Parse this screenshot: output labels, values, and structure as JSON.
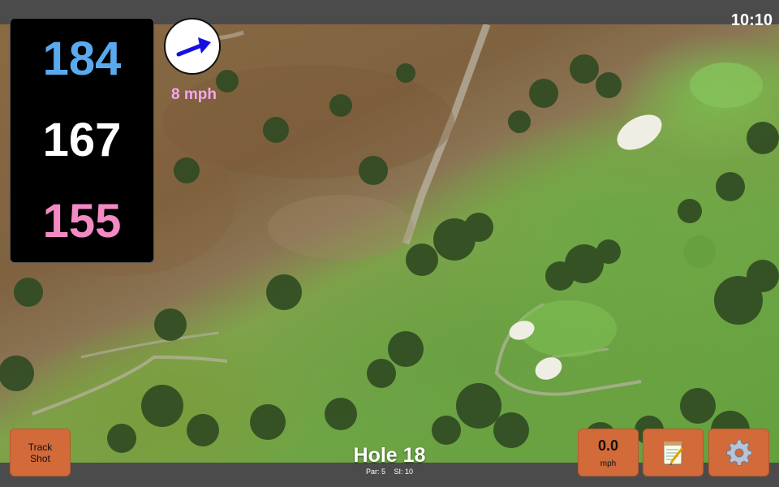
{
  "status_bar": {
    "time": "10:10"
  },
  "yardages": {
    "back": "184",
    "middle": "167",
    "front": "155"
  },
  "wind": {
    "speed_label": "8 mph",
    "direction_icon": "arrow-icon",
    "arrow_color": "#1410e0"
  },
  "hole": {
    "title": "Hole 18",
    "par": "Par: 5",
    "stroke_index": "SI: 10"
  },
  "buttons": {
    "track_shot_line1": "Track",
    "track_shot_line2": "Shot",
    "wind_value": "0.0",
    "wind_unit": "mph",
    "notes_icon": "notepad-icon",
    "settings_icon": "gear-icon"
  },
  "colors": {
    "button_bg": "#d26a3a",
    "back_yardage": "#5aa9ee",
    "middle_yardage": "#ffffff",
    "front_yardage": "#f48ac4",
    "wind_text": "#f3a8f0"
  }
}
